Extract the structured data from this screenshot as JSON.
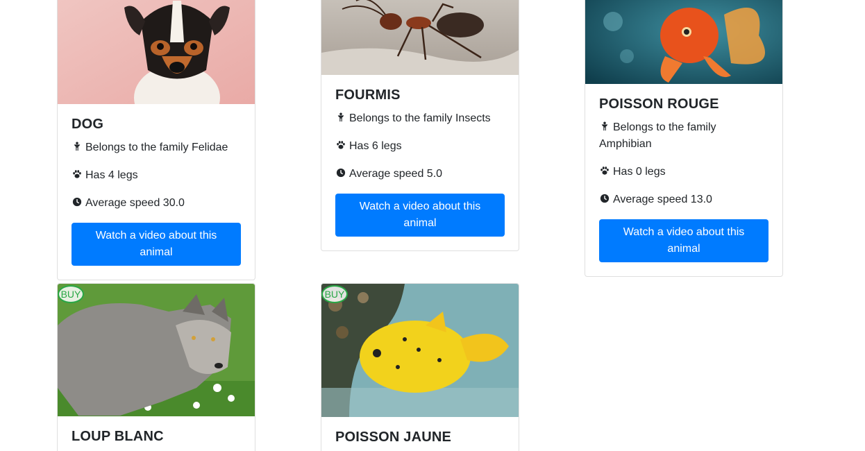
{
  "cards": [
    {
      "title": "DOG",
      "family": "Belongs to the family Felidae",
      "legs": "Has 4 legs",
      "speed": "Average speed 30.0",
      "button": "Watch a video about this animal"
    },
    {
      "title": "FOURMIS",
      "family": "Belongs to the family Insects",
      "legs": "Has 6 legs",
      "speed": "Average speed 5.0",
      "button": "Watch a video about this animal"
    },
    {
      "title": "POISSON ROUGE",
      "family": "Belongs to the family Amphibian",
      "legs": "Has 0 legs",
      "speed": "Average speed 13.0",
      "button": "Watch a video about this animal"
    },
    {
      "title": "LOUP BLANC",
      "badge": "BUY"
    },
    {
      "title": "POISSON JAUNE",
      "badge": "BUY"
    }
  ],
  "icons": {
    "family": "family-icon",
    "legs": "paw-icon",
    "speed": "clock-icon"
  },
  "colors": {
    "primary_button": "#007bff",
    "buy_badge": "#28a745"
  }
}
